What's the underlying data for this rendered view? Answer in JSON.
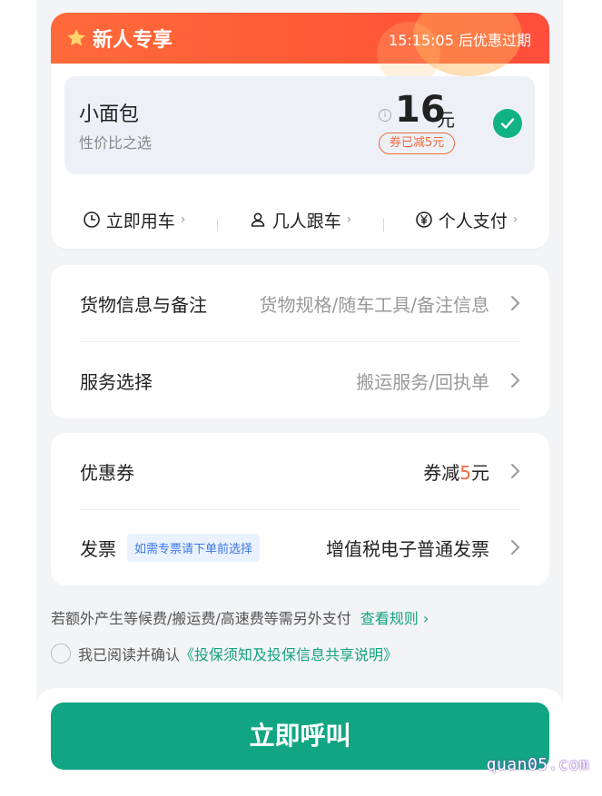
{
  "colors": {
    "accent_green": "#12a583",
    "promo_orange": "#ff5a36",
    "coupon_orange": "#f06a3e",
    "link_green": "#14a37f",
    "tag_blue": "#3b78e7"
  },
  "promo": {
    "title": "新人专享",
    "timer": "15:15:05 后优惠过期",
    "vehicle": {
      "name": "小面包",
      "desc": "性价比之选",
      "price": "16",
      "unit": "元",
      "coupon_badge": "券已减5元",
      "selected": true
    },
    "options": [
      {
        "label": "立即用车",
        "icon": "clock-icon"
      },
      {
        "label": "几人跟车",
        "icon": "person-icon"
      },
      {
        "label": "个人支付",
        "icon": "yen-icon"
      }
    ]
  },
  "cargo": {
    "label": "货物信息与备注",
    "placeholder": "货物规格/随车工具/备注信息"
  },
  "service": {
    "label": "服务选择",
    "placeholder": "搬运服务/回执单"
  },
  "coupon": {
    "label": "优惠券",
    "prefix": "券减",
    "amount": "5",
    "suffix": "元"
  },
  "invoice": {
    "label": "发票",
    "tag": "如需专票请下单前选择",
    "value": "增值税电子普通发票"
  },
  "notice": {
    "text": "若额外产生等候费/搬运费/高速费等需另外支付",
    "link": "查看规则"
  },
  "agree": {
    "text": "我已阅读并确认",
    "link": "《投保须知及投保信息共享说明》"
  },
  "call_button": "立即呼叫",
  "watermark": "quan05.com"
}
